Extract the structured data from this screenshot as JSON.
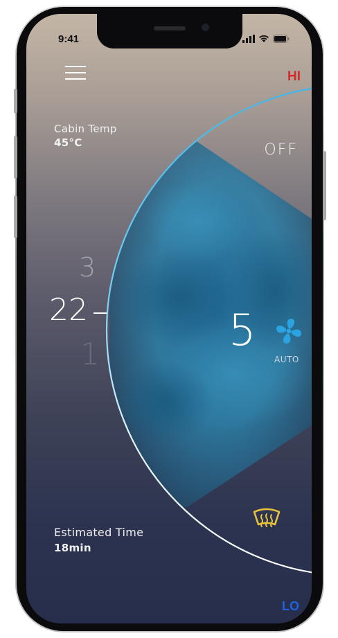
{
  "status_bar": {
    "time": "9:41",
    "icons": [
      "signal-icon",
      "wifi-icon",
      "battery-icon"
    ]
  },
  "header": {
    "menu_icon": "hamburger-icon",
    "hi_label": "HI"
  },
  "cabin": {
    "label": "Cabin Temp",
    "value": "45°C"
  },
  "mode": {
    "off_label": "OFF"
  },
  "temperature_dial": {
    "upper": "3",
    "current": "22",
    "lower": "1"
  },
  "fan": {
    "speed": "5",
    "icon": "fan-icon",
    "mode_label": "AUTO"
  },
  "defrost": {
    "icon": "windshield-defrost-icon"
  },
  "estimate": {
    "label": "Estimated Time",
    "value": "18min"
  },
  "footer": {
    "lo_label": "LO"
  },
  "colors": {
    "hi": "#d42a2a",
    "lo": "#1f63e0",
    "fan_icon": "#2aa3e0",
    "defrost_icon": "#e8c23a",
    "arc": "#3bb0e8"
  }
}
